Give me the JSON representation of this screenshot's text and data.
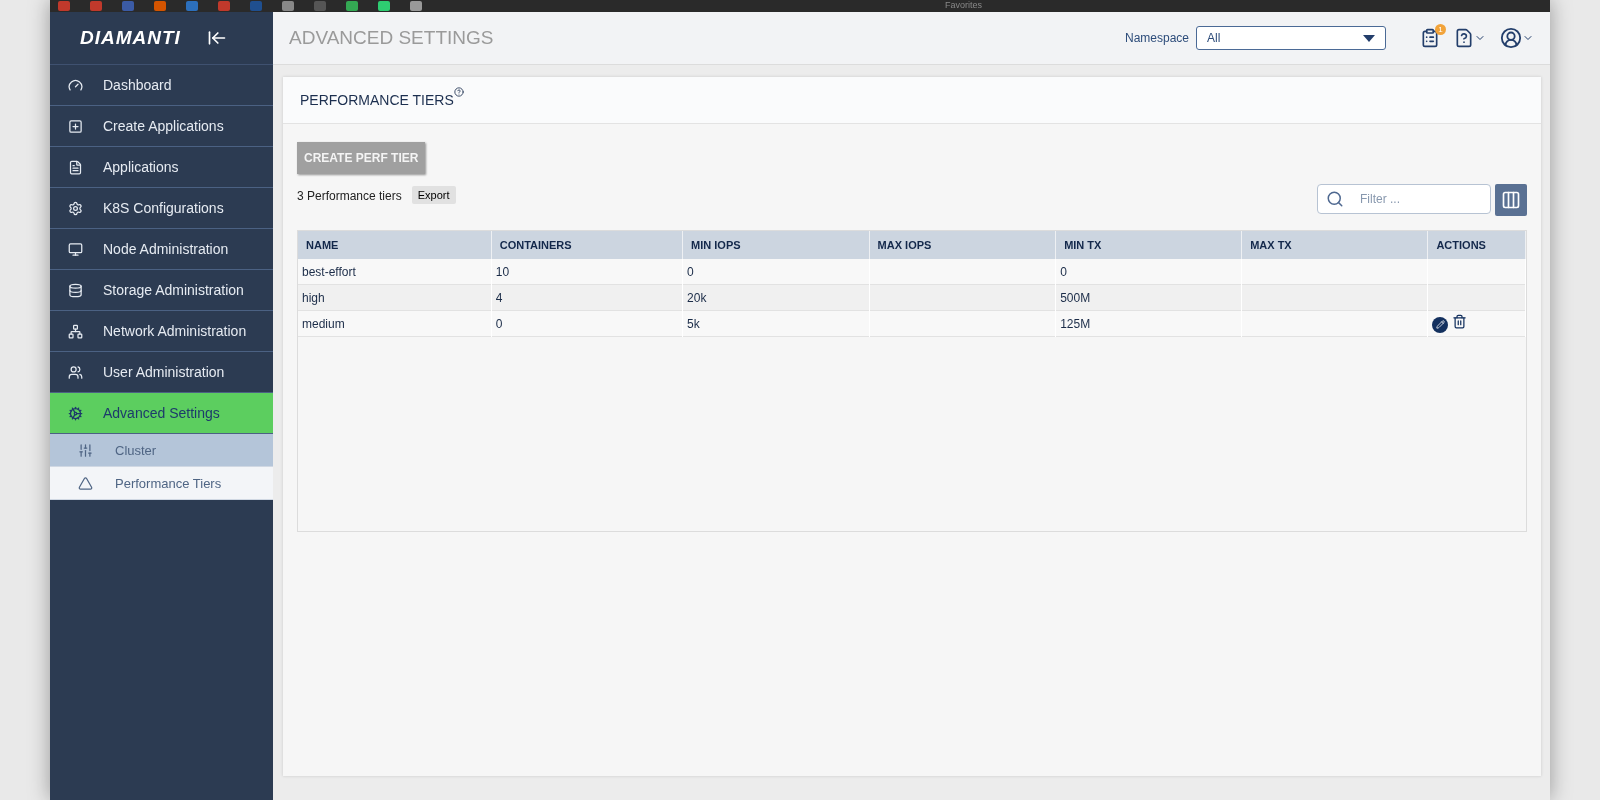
{
  "bookmarks_bar": {
    "title": "Favorites"
  },
  "sidebar": {
    "logo": "DIAMANTI",
    "items": [
      {
        "label": "Dashboard",
        "selected": false
      },
      {
        "label": "Create Applications",
        "selected": false
      },
      {
        "label": "Applications",
        "selected": false
      },
      {
        "label": "K8S Configurations",
        "selected": false
      },
      {
        "label": "Node Administration",
        "selected": false
      },
      {
        "label": "Storage Administration",
        "selected": false
      },
      {
        "label": "Network Administration",
        "selected": false
      },
      {
        "label": "User Administration",
        "selected": false
      },
      {
        "label": "Advanced Settings",
        "selected": true,
        "children": [
          {
            "label": "Cluster",
            "selected": false
          },
          {
            "label": "Performance Tiers",
            "selected": true
          }
        ]
      }
    ]
  },
  "header": {
    "title": "ADVANCED SETTINGS",
    "namespace_label": "Namespace",
    "namespace_value": "All",
    "tasks_badge": "1"
  },
  "panel": {
    "title": "PERFORMANCE TIERS",
    "create_button": "CREATE PERF TIER",
    "count": "3 Performance tiers",
    "export_button": "Export",
    "filter_placeholder": "Filter ...",
    "table": {
      "columns": [
        "NAME",
        "CONTAINERS",
        "MIN IOPS",
        "MAX IOPS",
        "MIN TX",
        "MAX TX",
        "ACTIONS"
      ],
      "rows": [
        {
          "cells": [
            "best-effort",
            "10",
            "0",
            "",
            "0",
            ""
          ],
          "show_actions": false
        },
        {
          "cells": [
            "high",
            "4",
            "20k",
            "",
            "500M",
            ""
          ],
          "show_actions": false
        },
        {
          "cells": [
            "medium",
            "0",
            "5k",
            "",
            "125M",
            ""
          ],
          "show_actions": true
        }
      ]
    }
  }
}
